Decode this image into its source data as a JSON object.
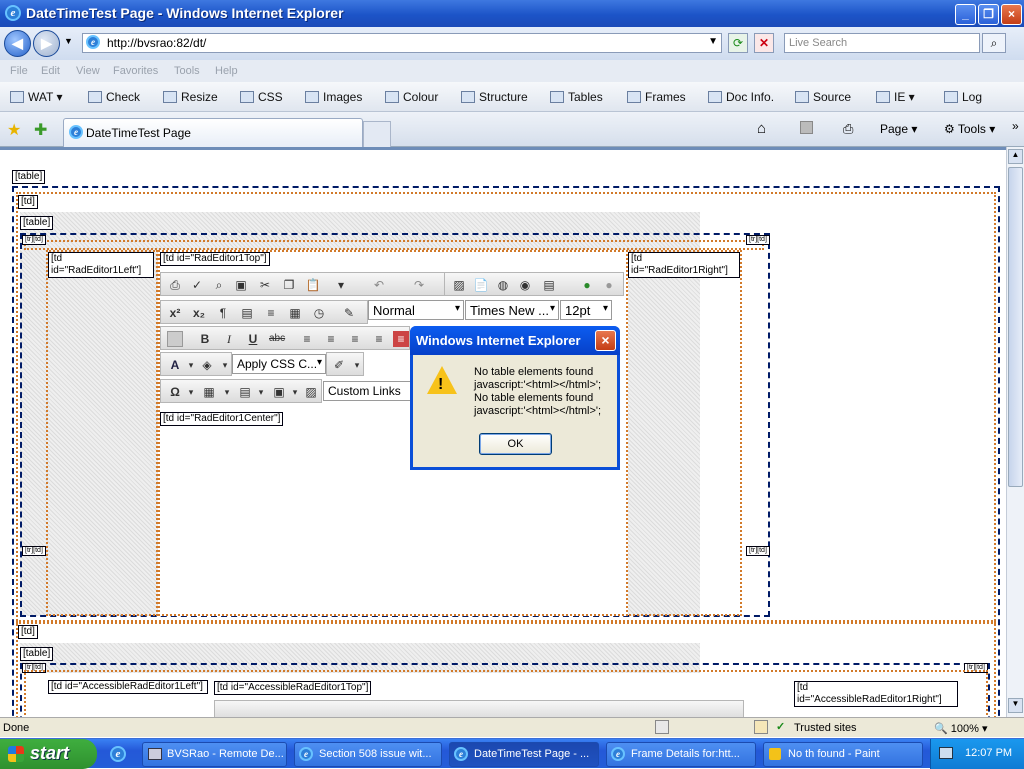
{
  "window": {
    "title": "DateTimeTest Page - Windows Internet Explorer"
  },
  "address": {
    "url": "http://bvsrao:82/dt/",
    "search_placeholder": "Live Search"
  },
  "menu": [
    "File",
    "Edit",
    "View",
    "Favorites",
    "Tools",
    "Help"
  ],
  "devbar": [
    "WAT",
    "Check",
    "Resize",
    "CSS",
    "Images",
    "Colour",
    "Structure",
    "Tables",
    "Frames",
    "Doc Info.",
    "Source",
    "IE",
    "Log"
  ],
  "tab": {
    "title": "DateTimeTest Page"
  },
  "cmdbar": {
    "page": "Page",
    "tools": "Tools"
  },
  "content": {
    "labels": {
      "table1": "[table]",
      "td1": "[td]",
      "table2": "[table]",
      "trtd": "[tr][td]",
      "left": "[td id=\"RadEditor1Left\"]",
      "top": "[td id=\"RadEditor1Top\"]",
      "right": "[td id=\"RadEditor1Right\"]",
      "center": "[td id=\"RadEditor1Center\"]",
      "td2": "[td]",
      "table3": "[table]",
      "aleft": "[td id=\"AccessibleRadEditor1Left\"]",
      "atop": "[td id=\"AccessibleRadEditor1Top\"]",
      "aright": "[td id=\"AccessibleRadEditor1Right\"]"
    },
    "editor": {
      "paragraph": "Normal",
      "font": "Times New ...",
      "size": "12pt",
      "css_class": "Apply CSS C...",
      "links": "Custom Links"
    }
  },
  "dialog": {
    "title": "Windows Internet Explorer",
    "lines": [
      "No table elements found",
      "javascript:'<html></html>';",
      "No table elements found",
      "javascript:'<html></html>';"
    ],
    "ok": "OK"
  },
  "status": {
    "text": "Done",
    "zone": "Trusted sites",
    "zoom": "100%"
  },
  "taskbar": {
    "start": "start",
    "tasks": [
      "BVSRao - Remote De...",
      "Section 508 issue wit...",
      "DateTimeTest Page - ...",
      "Frame Details for:htt...",
      "No th found - Paint"
    ],
    "clock": "12:07 PM"
  }
}
